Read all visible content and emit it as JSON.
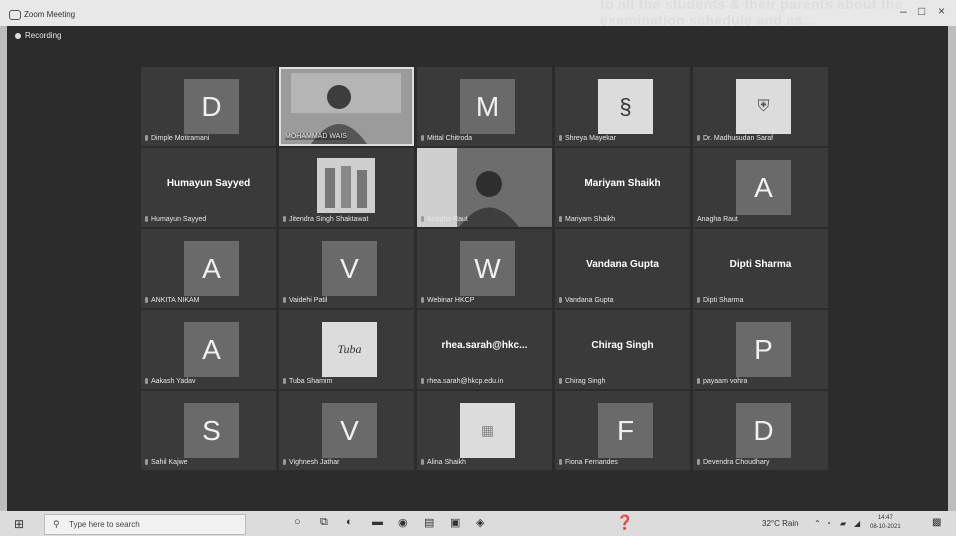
{
  "window": {
    "title": "Zoom Meeting",
    "minimize": "–",
    "maximize": "□",
    "close": "×",
    "bg_text": "to all the students & their parents about the examination schedule and as..."
  },
  "recording": {
    "label": "Recording"
  },
  "tiles": [
    {
      "name": "Dimple Motiramani",
      "initial": "D"
    },
    {
      "name": "MOHAMMAD WAIS"
    },
    {
      "name": "Mittal Chitroda",
      "initial": "M"
    },
    {
      "name": "Shreya Mayekar"
    },
    {
      "name": "Dr. Madhusudan Saraf"
    },
    {
      "name": "Humayun Sayyed",
      "display": "Humayun Sayyed"
    },
    {
      "name": "Jitendra Singh Shaktawat"
    },
    {
      "name": "Anagha Raut"
    },
    {
      "name": "Mariyam Shaikh",
      "display": "Mariyam Shaikh"
    },
    {
      "name": "Anagha Raut",
      "initial": "A"
    },
    {
      "name": "ANKITA NIKAM",
      "initial": "A"
    },
    {
      "name": "Vaidehi Patil",
      "initial": "V"
    },
    {
      "name": "Webinar HKCP",
      "initial": "W"
    },
    {
      "name": "Vandana Gupta",
      "display": "Vandana Gupta"
    },
    {
      "name": "Dipti Sharma",
      "display": "Dipti Sharma"
    },
    {
      "name": "Aakash Yadav",
      "initial": "A"
    },
    {
      "name": "Tuba Shamim",
      "logo": "Tuba"
    },
    {
      "name": "rhea.sarah@hkcp.edu.in",
      "display": "rhea.sarah@hkc..."
    },
    {
      "name": "Chirag Singh",
      "display": "Chirag Singh"
    },
    {
      "name": "payaam vohra",
      "initial": "P"
    },
    {
      "name": "Sahil Kajwe",
      "initial": "S"
    },
    {
      "name": "Vighnesh Jathar",
      "initial": "V"
    },
    {
      "name": "Alina Shaikh"
    },
    {
      "name": "Fiona Fernandes",
      "initial": "F"
    },
    {
      "name": "Devendra Choudhary",
      "initial": "D"
    }
  ],
  "taskbar": {
    "search_placeholder": "Type here to search",
    "weather": "32°C Rain",
    "time": "14:47",
    "date": "08-10-2021"
  },
  "colors": {
    "stage": "#2c2c2c",
    "tile": "#3a3a3a",
    "avatar": "#6a6a6a"
  }
}
